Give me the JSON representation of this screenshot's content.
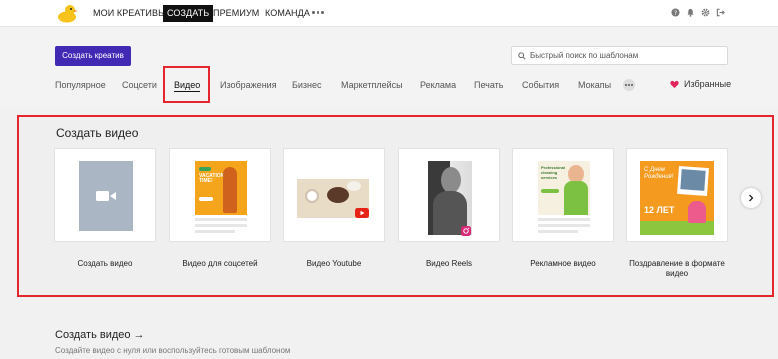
{
  "topnav": {
    "items": [
      "МОИ КРЕАТИВЫ",
      "СОЗДАТЬ",
      "ПРЕМИУМ",
      "КОМАНДА"
    ],
    "active": "СОЗДАТЬ"
  },
  "header": {
    "create_button": "Создать креатив",
    "search_placeholder": "Быстрый поиск по шаблонам"
  },
  "categories": [
    "Популярное",
    "Соцсети",
    "Видео",
    "Изображения",
    "Бизнес",
    "Маркетплейсы",
    "Реклама",
    "Печать",
    "События",
    "Мокапы"
  ],
  "active_category": "Видео",
  "favorites_label": "Избранные",
  "section": {
    "title": "Создать видео",
    "cards": [
      {
        "label": "Создать видео"
      },
      {
        "label": "Видео для соцсетей",
        "thumb_text": [
          "VACATION",
          "TIME!"
        ]
      },
      {
        "label": "Видео Youtube"
      },
      {
        "label": "Видео Reels"
      },
      {
        "label": "Рекламное видео",
        "thumb_text": [
          "Professional",
          "cleaning",
          "services"
        ]
      },
      {
        "label": "Поздравление в формате видео",
        "thumb_text": [
          "С Днем",
          "Рождения!",
          "12 ЛЕТ"
        ]
      }
    ]
  },
  "bottom": {
    "title": "Создать видео →",
    "subtitle": "Создайте видео с нуля или воспользуйтесь готовым шаблоном"
  },
  "colors": {
    "accent": "#4229b3",
    "highlight": "#e5262d",
    "favorite": "#e0245e"
  }
}
